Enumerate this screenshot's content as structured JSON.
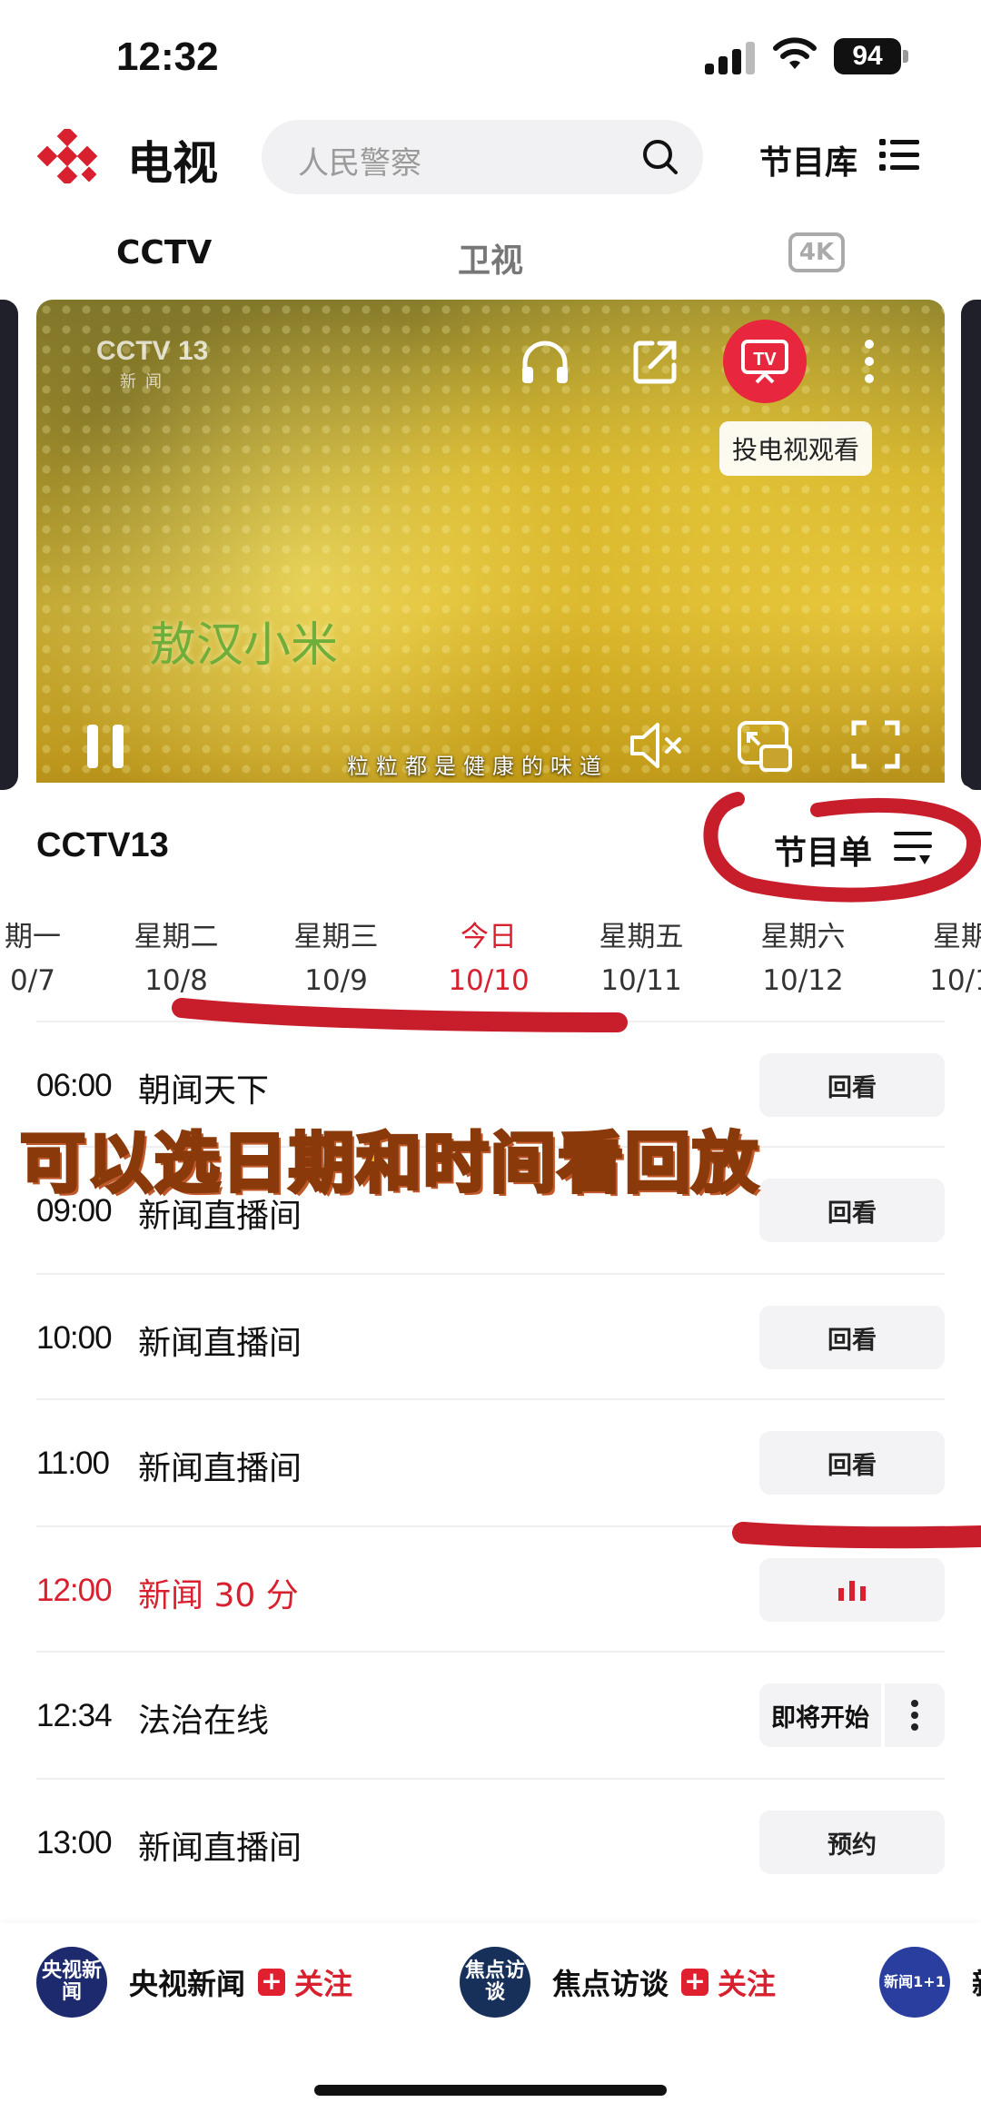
{
  "status": {
    "time": "12:32",
    "battery": "94"
  },
  "header": {
    "brand": "电视",
    "search_placeholder": "人民警察",
    "library_label": "节目库"
  },
  "tabs": [
    {
      "label": "CCTV"
    },
    {
      "label": "卫视"
    },
    {
      "label": "4K"
    }
  ],
  "player": {
    "channel_logo": "CCTV 13",
    "channel_sub": "新闻",
    "cast_tooltip": "投电视观看",
    "caption": "敖汉小米",
    "subtitle": "粒粒都是健康的味道"
  },
  "panel": {
    "channel": "CCTV13",
    "epg_label": "节目单",
    "days": [
      {
        "weekday": "期一",
        "date": "0/7"
      },
      {
        "weekday": "星期二",
        "date": "10/8"
      },
      {
        "weekday": "星期三",
        "date": "10/9"
      },
      {
        "weekday": "今日",
        "date": "10/10"
      },
      {
        "weekday": "星期五",
        "date": "10/11"
      },
      {
        "weekday": "星期六",
        "date": "10/12"
      },
      {
        "weekday": "星期",
        "date": "10/1"
      }
    ],
    "programs": [
      {
        "time": "06:00",
        "name": "朝闻天下",
        "action": "回看"
      },
      {
        "time": "09:00",
        "name": "新闻直播间",
        "action": "回看"
      },
      {
        "time": "10:00",
        "name": "新闻直播间",
        "action": "回看"
      },
      {
        "time": "11:00",
        "name": "新闻直播间",
        "action": "回看"
      },
      {
        "time": "12:00",
        "name": "新闻 30 分",
        "action": ""
      },
      {
        "time": "12:34",
        "name": "法治在线",
        "action": "即将开始"
      },
      {
        "time": "13:00",
        "name": "新闻直播间",
        "action": "预约"
      }
    ]
  },
  "annotation": {
    "text": "可以选日期和时间看回放"
  },
  "accounts": [
    {
      "avatar_text": "央视新闻",
      "name": "央视新闻",
      "follow": "关注"
    },
    {
      "avatar_text": "焦点访谈",
      "name": "焦点访谈",
      "follow": "关注"
    },
    {
      "avatar_text": "新闻1+1",
      "name": "新"
    }
  ],
  "colors": {
    "accent": "#d8202f",
    "cast": "#e8263e"
  }
}
